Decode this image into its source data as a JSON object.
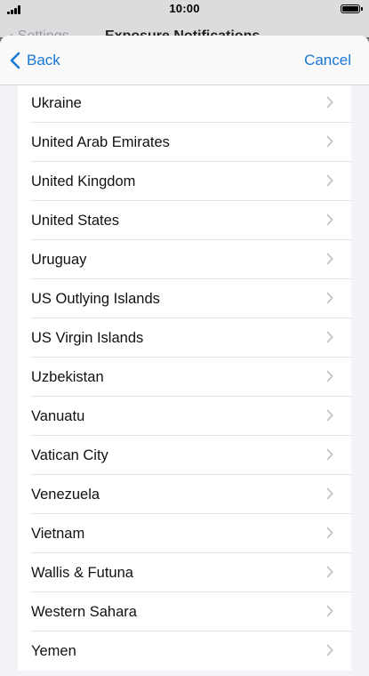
{
  "status_bar": {
    "time": "10:00"
  },
  "background_screen": {
    "back_label": "Settings",
    "title": "Exposure Notifications"
  },
  "sheet": {
    "back_label": "Back",
    "cancel_label": "Cancel",
    "accent_color": "#1877d6"
  },
  "countries": [
    "Ukraine",
    "United Arab Emirates",
    "United Kingdom",
    "United States",
    "Uruguay",
    "US Outlying Islands",
    "US Virgin Islands",
    "Uzbekistan",
    "Vanuatu",
    "Vatican City",
    "Venezuela",
    "Vietnam",
    "Wallis & Futuna",
    "Western Sahara",
    "Yemen"
  ]
}
